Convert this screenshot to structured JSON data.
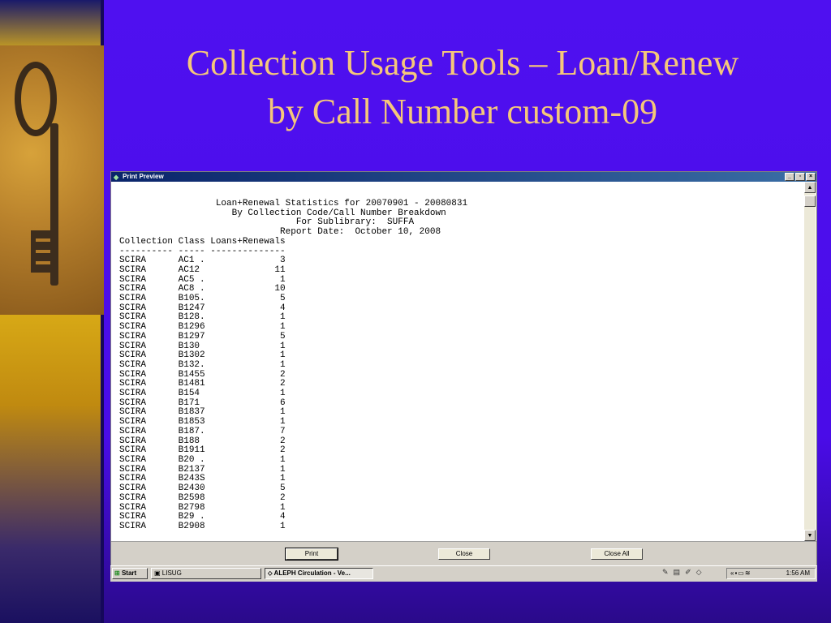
{
  "slide": {
    "title_line1": "Collection Usage Tools – Loan/Renew",
    "title_line2": "by Call Number custom-09",
    "title_color": "#f5c77a",
    "background_color": "#4a0ce8"
  },
  "window": {
    "title": "Print Preview",
    "controls": {
      "minimize": "_",
      "restore": "▫",
      "close": "×"
    }
  },
  "report": {
    "header": [
      "                  Loan+Renewal Statistics for 20070901 - 20080831",
      "                     By Collection Code/Call Number Breakdown",
      "                                 For Sublibrary:  SUFFA",
      "                              Report Date:  October 10, 2008"
    ],
    "columns": [
      "Collection",
      "Class",
      "Loans+Renewals"
    ],
    "separator": "---------- ----- --------------",
    "rows": [
      [
        "SCIRA",
        "AC1 .",
        "3"
      ],
      [
        "SCIRA",
        "AC12",
        "11"
      ],
      [
        "SCIRA",
        "AC5 .",
        "1"
      ],
      [
        "SCIRA",
        "AC8 .",
        "10"
      ],
      [
        "SCIRA",
        "B105.",
        "5"
      ],
      [
        "SCIRA",
        "B1247",
        "4"
      ],
      [
        "SCIRA",
        "B128.",
        "1"
      ],
      [
        "SCIRA",
        "B1296",
        "1"
      ],
      [
        "SCIRA",
        "B1297",
        "5"
      ],
      [
        "SCIRA",
        "B130",
        "1"
      ],
      [
        "SCIRA",
        "B1302",
        "1"
      ],
      [
        "SCIRA",
        "B132.",
        "1"
      ],
      [
        "SCIRA",
        "B1455",
        "2"
      ],
      [
        "SCIRA",
        "B1481",
        "2"
      ],
      [
        "SCIRA",
        "B154",
        "1"
      ],
      [
        "SCIRA",
        "B171",
        "6"
      ],
      [
        "SCIRA",
        "B1837",
        "1"
      ],
      [
        "SCIRA",
        "B1853",
        "1"
      ],
      [
        "SCIRA",
        "B187.",
        "7"
      ],
      [
        "SCIRA",
        "B188",
        "2"
      ],
      [
        "SCIRA",
        "B1911",
        "2"
      ],
      [
        "SCIRA",
        "B20 .",
        "1"
      ],
      [
        "SCIRA",
        "B2137",
        "1"
      ],
      [
        "SCIRA",
        "B243S",
        "1"
      ],
      [
        "SCIRA",
        "B2430",
        "5"
      ],
      [
        "SCIRA",
        "B2598",
        "2"
      ],
      [
        "SCIRA",
        "B2798",
        "1"
      ],
      [
        "SCIRA",
        "B29 .",
        "4"
      ],
      [
        "SCIRA",
        "B2908",
        "1"
      ]
    ]
  },
  "buttons": {
    "print": "Print",
    "close": "Close",
    "close_all": "Close All"
  },
  "taskbar": {
    "start": "Start",
    "tasks": [
      "LISUG",
      "ALEPH Circulation - Ve..."
    ],
    "clock": "1:56 AM"
  }
}
